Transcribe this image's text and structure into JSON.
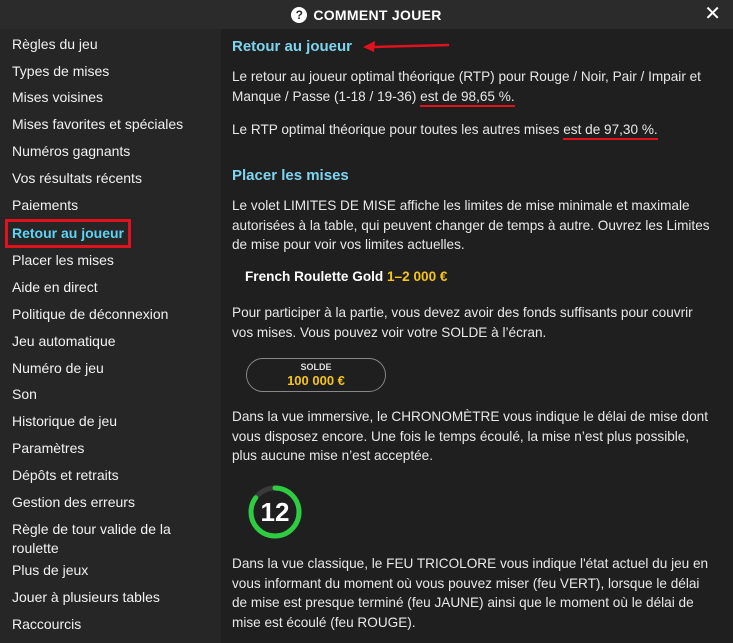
{
  "header": {
    "title": "COMMENT JOUER",
    "help_icon": "?",
    "close_icon": "✕"
  },
  "sidebar": {
    "items": [
      {
        "label": "Règles du jeu"
      },
      {
        "label": "Types de mises"
      },
      {
        "label": "Mises voisines"
      },
      {
        "label": "Mises favorites et spéciales"
      },
      {
        "label": "Numéros gagnants"
      },
      {
        "label": "Vos résultats récents"
      },
      {
        "label": "Paiements"
      },
      {
        "label": "Retour au joueur"
      },
      {
        "label": "Placer les mises"
      },
      {
        "label": "Aide en direct"
      },
      {
        "label": "Politique de déconnexion"
      },
      {
        "label": "Jeu automatique"
      },
      {
        "label": "Numéro de jeu"
      },
      {
        "label": "Son"
      },
      {
        "label": "Historique de jeu"
      },
      {
        "label": "Paramètres"
      },
      {
        "label": "Dépôts et retraits"
      },
      {
        "label": "Gestion des erreurs"
      },
      {
        "label": "Règle de tour valide de la roulette"
      },
      {
        "label": "Plus de jeux"
      },
      {
        "label": "Jouer à plusieurs tables"
      },
      {
        "label": "Raccourcis"
      }
    ],
    "active_index": 7
  },
  "main": {
    "rtp_title": "Retour au joueur",
    "rtp_p1_pre": "Le retour au joueur optimal théorique (RTP) pour Rouge / Noir, Pair / Impair et Manque / Passe (1-18 / 19-36) ",
    "rtp_p1_value": "est de 98,65 %.",
    "rtp_p2_pre": "Le RTP optimal théorique pour toutes les autres mises ",
    "rtp_p2_value": "est de 97,30 %.",
    "bets_title": "Placer les mises",
    "bets_p1": "Le volet LIMITES DE MISE affiche les limites de mise minimale et maximale autorisées à la table, qui peuvent changer de temps à autre. Ouvrez les Limites de mise pour voir vos limites actuelles.",
    "limit_name": "French Roulette Gold",
    "limit_range": "1–2 000 €",
    "bets_p2": "Pour participer à la partie, vous devez avoir des fonds suffisants pour couvrir vos mises. Vous pouvez voir votre SOLDE à l’écran.",
    "solde_label": "SOLDE",
    "solde_value": "100 000 €",
    "bets_p3": "Dans la vue immersive, le CHRONOMÈTRE vous indique le délai de mise dont vous disposez encore. Une fois le temps écoulé, la mise n’est plus possible, plus aucune mise n’est acceptée.",
    "timer_value": "12",
    "timer_fraction": 0.85,
    "bets_p4": "Dans la vue classique, le FEU TRICOLORE vous indique l'état actuel du jeu en vous informant du moment où vous pouvez miser (feu VERT), lorsque le délai de mise est presque terminé (feu JAUNE) ainsi que le moment où le délai de mise est écoulé (feu ROUGE)."
  },
  "colors": {
    "accent": "#7ed4ee",
    "highlight": "#e0121d",
    "gold": "#f5c518",
    "timer_green": "#2ecc40"
  }
}
